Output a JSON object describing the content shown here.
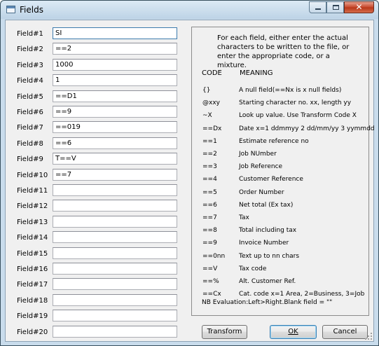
{
  "window": {
    "title": "Fields",
    "close_symbol": "✕",
    "icons": {
      "app": "form-icon",
      "minimize": "minimize-icon",
      "maximize": "maximize-icon",
      "close": "close-icon"
    }
  },
  "fields": [
    {
      "label": "Field#1",
      "value": "SI"
    },
    {
      "label": "Field#2",
      "value": "==2"
    },
    {
      "label": "Field#3",
      "value": "1000"
    },
    {
      "label": "Field#4",
      "value": "1"
    },
    {
      "label": "Field#5",
      "value": "==D1"
    },
    {
      "label": "Field#6",
      "value": "==9"
    },
    {
      "label": "Field#7",
      "value": "==019"
    },
    {
      "label": "Field#8",
      "value": "==6"
    },
    {
      "label": "Field#9",
      "value": "T==V"
    },
    {
      "label": "Field#10",
      "value": "==7"
    },
    {
      "label": "Field#11",
      "value": ""
    },
    {
      "label": "Field#12",
      "value": ""
    },
    {
      "label": "Field#13",
      "value": ""
    },
    {
      "label": "Field#14",
      "value": ""
    },
    {
      "label": "Field#15",
      "value": ""
    },
    {
      "label": "Field#16",
      "value": ""
    },
    {
      "label": "Field#17",
      "value": ""
    },
    {
      "label": "Field#18",
      "value": ""
    },
    {
      "label": "Field#19",
      "value": ""
    },
    {
      "label": "Field#20",
      "value": ""
    }
  ],
  "help": {
    "intro": "For each field, either enter the actual characters to be written to the file, or enter the appropriate code, or a mixture.",
    "code_header": "CODE",
    "meaning_header": "MEANING",
    "codes": [
      {
        "code": "{}",
        "meaning": "A null field(==Nx is x null fields)"
      },
      {
        "code": "@xxy",
        "meaning": "Starting character no. xx, length yy"
      },
      {
        "code": "~X",
        "meaning": "Look up value. Use Transform Code X"
      },
      {
        "code": "==Dx",
        "meaning": "Date x=1 ddmmyy 2 dd/mm/yy 3 yymmdd"
      },
      {
        "code": "==1",
        "meaning": "Estimate reference no"
      },
      {
        "code": "==2",
        "meaning": "Job NUmber"
      },
      {
        "code": "==3",
        "meaning": "Job Reference"
      },
      {
        "code": "==4",
        "meaning": "Customer Reference"
      },
      {
        "code": "==5",
        "meaning": "Order Number"
      },
      {
        "code": "==6",
        "meaning": "Net total (Ex tax)"
      },
      {
        "code": "==7",
        "meaning": "Tax"
      },
      {
        "code": "==8",
        "meaning": "Total including tax"
      },
      {
        "code": "==9",
        "meaning": "Invoice Number"
      },
      {
        "code": "==0nn",
        "meaning": "Text up to nn chars"
      },
      {
        "code": "==V",
        "meaning": "Tax code"
      },
      {
        "code": "==%",
        "meaning": "Alt. Customer Ref."
      },
      {
        "code": "==Cx",
        "meaning": "Cat. code x=1 Area, 2=Business, 3=Job"
      }
    ],
    "nb": "NB Evaluation:Left>Right.Blank field = \"\""
  },
  "buttons": {
    "transform": "Transform",
    "ok": "OK",
    "cancel": "Cancel"
  }
}
